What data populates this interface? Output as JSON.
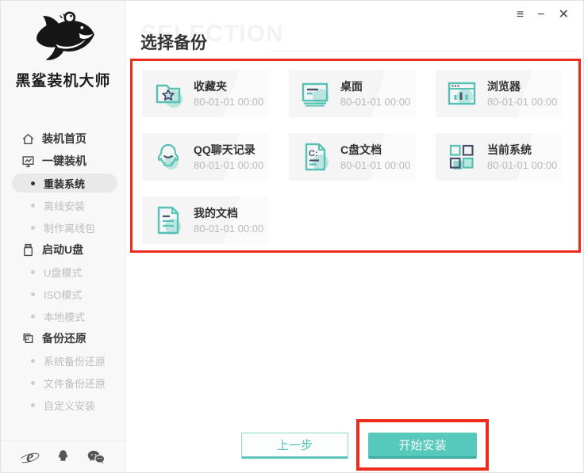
{
  "window_controls": {
    "menu_glyph": "≡",
    "minimize_glyph": "−",
    "close_glyph": "✕"
  },
  "sidebar": {
    "logo_text": "黑鲨装机大师",
    "items": [
      {
        "label": "装机首页",
        "type": "top",
        "icon": "home-icon"
      },
      {
        "label": "一键装机",
        "type": "top",
        "icon": "monitor-chart-icon"
      },
      {
        "label": "重装系统",
        "type": "sub",
        "active": true
      },
      {
        "label": "离线安装",
        "type": "sub"
      },
      {
        "label": "制作离线包",
        "type": "sub"
      },
      {
        "label": "启动U盘",
        "type": "top",
        "icon": "usb-drive-icon"
      },
      {
        "label": "U盘模式",
        "type": "sub"
      },
      {
        "label": "ISO模式",
        "type": "sub"
      },
      {
        "label": "本地模式",
        "type": "sub"
      },
      {
        "label": "备份还原",
        "type": "top",
        "icon": "backup-restore-icon"
      },
      {
        "label": "系统备份还原",
        "type": "sub"
      },
      {
        "label": "文件备份还原",
        "type": "sub"
      },
      {
        "label": "自定义安装",
        "type": "sub"
      }
    ],
    "footer_icons": [
      "ie-browser-icon",
      "qq-icon",
      "wechat-icon"
    ]
  },
  "header": {
    "title": "选择备份",
    "watermark": "SELECTION"
  },
  "backups": {
    "cards": [
      {
        "label": "收藏夹",
        "date": "80-01-01 00:00",
        "icon": "favorites-folder-icon"
      },
      {
        "label": "桌面",
        "date": "80-01-01 00:00",
        "icon": "desktop-icon"
      },
      {
        "label": "浏览器",
        "date": "80-01-01 00:00",
        "icon": "browser-icon"
      },
      {
        "label": "QQ聊天记录",
        "date": "80-01-01 00:00",
        "icon": "qq-penguin-icon"
      },
      {
        "label": "C盘文档",
        "date": "80-01-01 00:00",
        "icon": "c-drive-document-icon"
      },
      {
        "label": "当前系统",
        "date": "80-01-01 00:00",
        "icon": "current-system-icon"
      },
      {
        "label": "我的文档",
        "date": "80-01-01 00:00",
        "icon": "my-documents-icon"
      }
    ]
  },
  "footer": {
    "back_label": "上一步",
    "install_label": "开始安装"
  },
  "colors": {
    "accent_teal": "#57c8bc",
    "accent_teal_light": "#bde5df",
    "icon_navy": "#46536d",
    "highlight_red": "#ee2a1c",
    "text_dark": "#333333",
    "text_muted": "#b9b9b9",
    "sidebar_bg": "#f8f8f8"
  }
}
